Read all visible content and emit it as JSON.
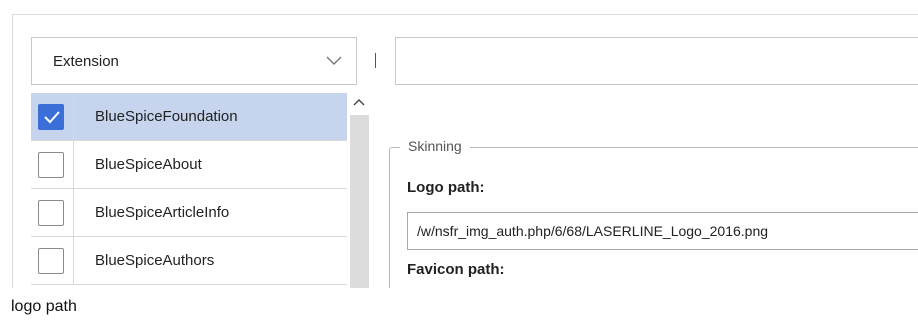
{
  "filter": {
    "selected": "Extension",
    "icon": "chevron-down-icon"
  },
  "search": {
    "value": "",
    "placeholder": ""
  },
  "extensions": [
    {
      "label": "BlueSpiceFoundation",
      "checked": true
    },
    {
      "label": "BlueSpiceAbout",
      "checked": false
    },
    {
      "label": "BlueSpiceArticleInfo",
      "checked": false
    },
    {
      "label": "BlueSpiceAuthors",
      "checked": false
    }
  ],
  "skinning": {
    "legend": "Skinning",
    "logo_path_label": "Logo path:",
    "logo_path_value": "/w/nsfr_img_auth.php/6/68/LASERLINE_Logo_2016.png",
    "favicon_path_label": "Favicon path:"
  },
  "tooltip": {
    "text": "logo path"
  },
  "colors": {
    "selected_row": "#c6d4ee",
    "checkbox_checked": "#3a6fd8",
    "border": "#c8c8c8"
  }
}
